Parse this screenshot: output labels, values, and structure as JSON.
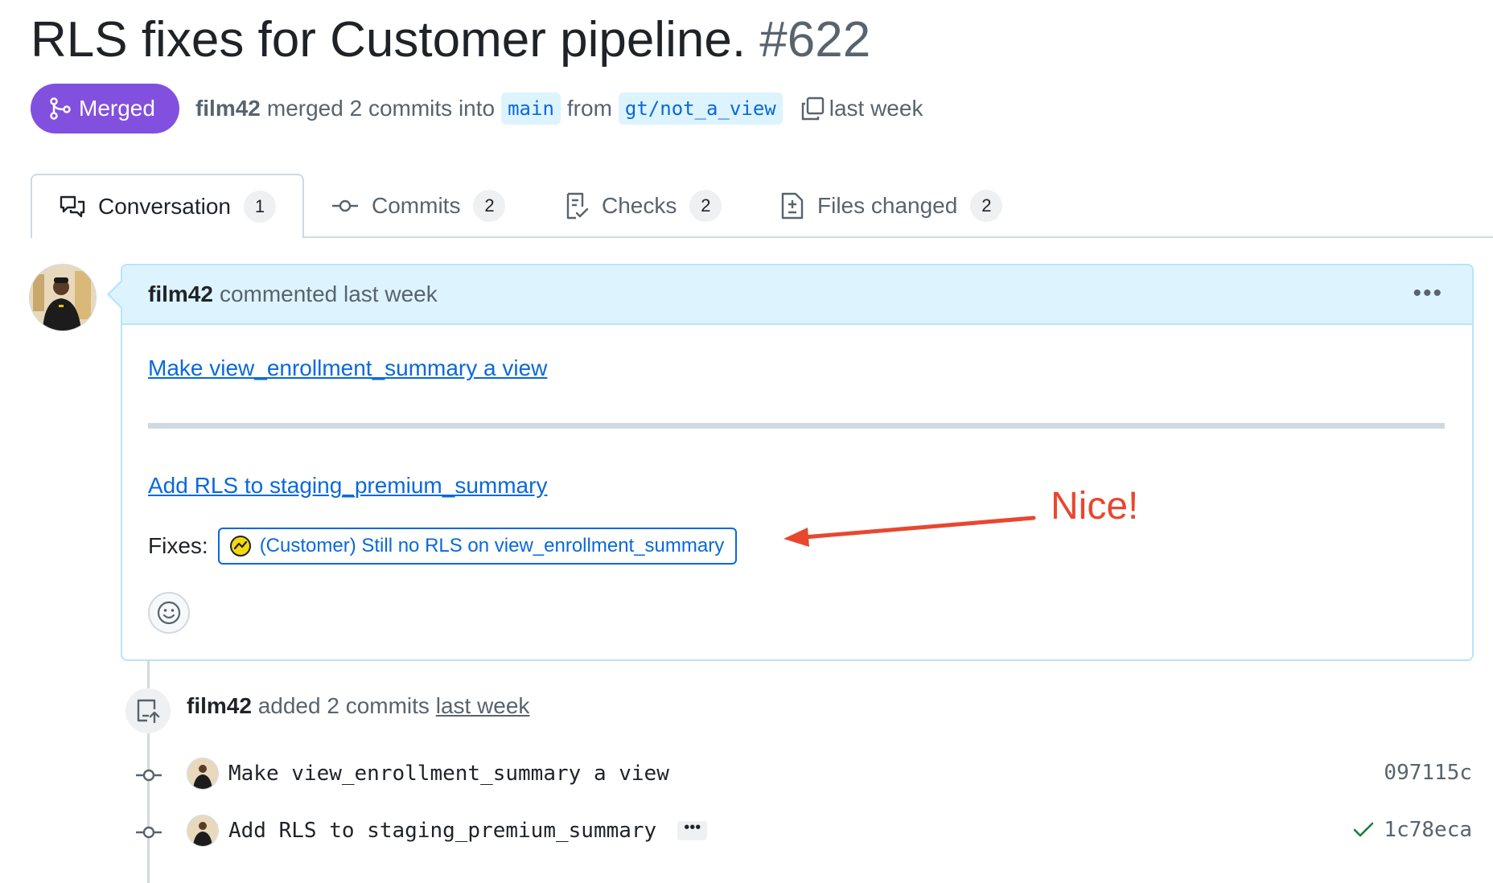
{
  "pr": {
    "title": "RLS fixes for Customer pipeline.",
    "number": "#622",
    "status": "Merged",
    "author": "film42",
    "merged_text": "merged 2 commits into",
    "base_branch": "main",
    "from_text": "from",
    "head_branch": "gt/not_a_view",
    "time": "last week"
  },
  "tabs": [
    {
      "label": "Conversation",
      "count": "1",
      "icon": "comment-discussion-icon"
    },
    {
      "label": "Commits",
      "count": "2",
      "icon": "git-commit-icon"
    },
    {
      "label": "Checks",
      "count": "2",
      "icon": "checklist-icon"
    },
    {
      "label": "Files changed",
      "count": "2",
      "icon": "file-diff-icon"
    }
  ],
  "comment": {
    "author": "film42",
    "action": "commented last week",
    "link1": "Make view_enrollment_summary a view",
    "link2": "Add RLS to staging_premium_summary",
    "fixes_label": "Fixes:",
    "issue": "(Customer) Still no RLS on view_enrollment_summary"
  },
  "annotation": {
    "text": "Nice!",
    "color": "#e8472f"
  },
  "push_event": {
    "author": "film42",
    "action": "added 2 commits",
    "time": "last week"
  },
  "commits": [
    {
      "message": "Make view_enrollment_summary a view",
      "sha": "097115c",
      "verified": false
    },
    {
      "message": "Add RLS to staging_premium_summary",
      "sha": "1c78eca",
      "verified": true
    }
  ],
  "colors": {
    "merged": "#8250df",
    "link": "#0969da",
    "header_bg": "#ddf4ff"
  }
}
